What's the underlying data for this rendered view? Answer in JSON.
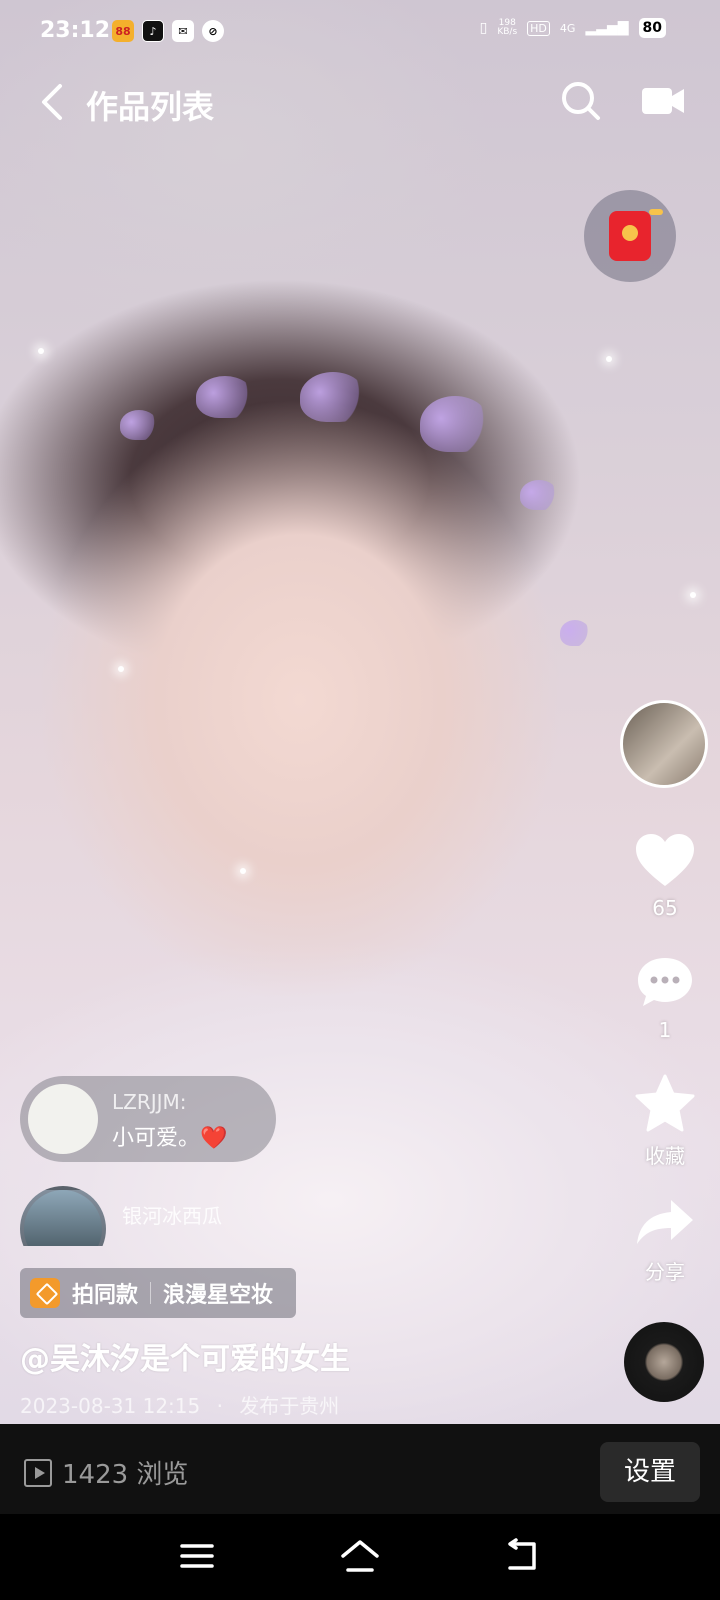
{
  "status_bar": {
    "time": "23:12",
    "net_speed_value": "198",
    "net_speed_unit": "KB/s",
    "hd": "HD",
    "network": "4G",
    "battery": "80"
  },
  "nav": {
    "title": "作品列表",
    "icons": [
      "back-icon",
      "search-icon",
      "camera-icon"
    ]
  },
  "actions": {
    "like_count": "65",
    "comment_count": "1",
    "favorite_label": "收藏",
    "share_label": "分享"
  },
  "danmaku": [
    {
      "user": "LZRJJM:",
      "text": "小可爱。❤️"
    },
    {
      "user": "银河冰西瓜",
      "text": ""
    }
  ],
  "effect": {
    "same_label": "拍同款",
    "name": "浪漫星空妆"
  },
  "post": {
    "description": "@吴沐汐是个可爱的女生",
    "datetime": "2023-08-31 12:15",
    "separator": "·",
    "location": "发布于贵州"
  },
  "bottom": {
    "views": "1423 浏览",
    "settings_label": "设置"
  },
  "colors": {
    "like": "#ffffff",
    "red_packet": "#e8242d",
    "effect_icon": "#f39a2b",
    "bottom_bar": "#111111"
  }
}
